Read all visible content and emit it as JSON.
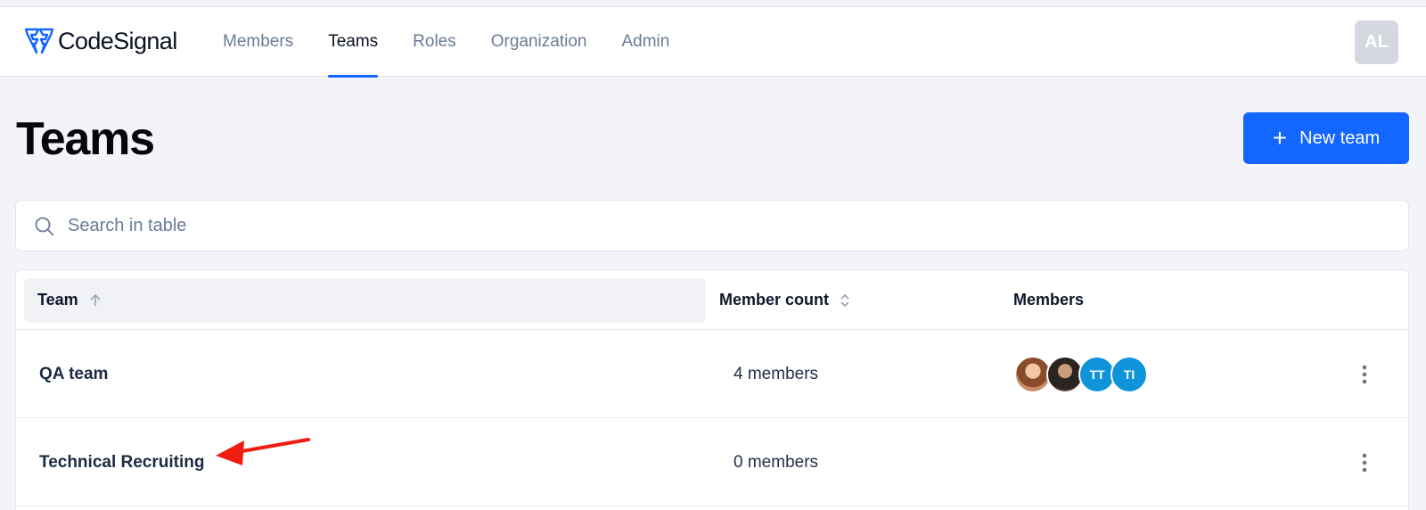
{
  "app": {
    "brand": "CodeSignal"
  },
  "nav": {
    "tabs": [
      {
        "label": "Members",
        "active": false
      },
      {
        "label": "Teams",
        "active": true
      },
      {
        "label": "Roles",
        "active": false
      },
      {
        "label": "Organization",
        "active": false
      },
      {
        "label": "Admin",
        "active": false
      }
    ],
    "user_initials": "AL"
  },
  "page": {
    "title": "Teams",
    "new_team_label": "New team",
    "new_team_icon": "plus-icon"
  },
  "search": {
    "placeholder": "Search in table",
    "value": ""
  },
  "table": {
    "headers": {
      "team": "Team",
      "member_count": "Member count",
      "members": "Members"
    },
    "rows": [
      {
        "team": "QA team",
        "member_count": "4 members",
        "avatars": [
          {
            "type": "photo",
            "label": ""
          },
          {
            "type": "photo",
            "label": ""
          },
          {
            "type": "initials",
            "label": "TT"
          },
          {
            "type": "initials",
            "label": "TI"
          }
        ]
      },
      {
        "team": "Technical Recruiting",
        "member_count": "0 members",
        "avatars": []
      }
    ]
  },
  "colors": {
    "accent": "#1366ff",
    "avatar_initials_bg": "#0f93db",
    "annotation_arrow": "#ef1d10"
  }
}
